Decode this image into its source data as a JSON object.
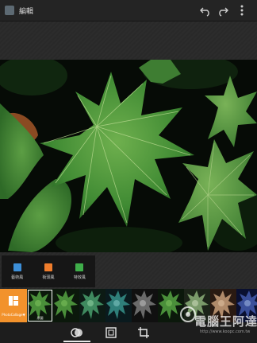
{
  "topbar": {
    "title": "編輯",
    "buttons": [
      {
        "name": "undo-icon"
      },
      {
        "name": "redo-icon"
      },
      {
        "name": "more-vert-icon"
      }
    ]
  },
  "style_tabs": [
    {
      "label": "藝術風",
      "icon": "art-style-icon",
      "color": "#3d8fd8"
    },
    {
      "label": "街頭風",
      "icon": "street-style-icon",
      "color": "#ef7d2c"
    },
    {
      "label": "特效風",
      "icon": "effects-style-icon",
      "color": "#3fae4a"
    }
  ],
  "filmstrip": {
    "original_label": "PhotoCollage▼",
    "thumbs": [
      {
        "label": "原圖",
        "tone": "normal",
        "selected": true
      },
      {
        "label": "",
        "tone": "normal"
      },
      {
        "label": "",
        "tone": "cool"
      },
      {
        "label": "",
        "tone": "teal"
      },
      {
        "label": "",
        "tone": "mono"
      },
      {
        "label": "",
        "tone": "normal"
      },
      {
        "label": "",
        "tone": "fade"
      },
      {
        "label": "",
        "tone": "warm"
      },
      {
        "label": "",
        "tone": "blue"
      }
    ]
  },
  "bottombar": {
    "buttons": [
      {
        "name": "filters-icon",
        "active": true
      },
      {
        "name": "frame-icon",
        "active": false
      },
      {
        "name": "crop-icon",
        "active": false
      }
    ]
  },
  "watermark": {
    "text": "電腦王阿達",
    "url": "http://www.koopc.com.tw"
  },
  "colors": {
    "accent": "#f2922c",
    "background": "#2b2b2b",
    "bar": "#1d1d1d"
  }
}
